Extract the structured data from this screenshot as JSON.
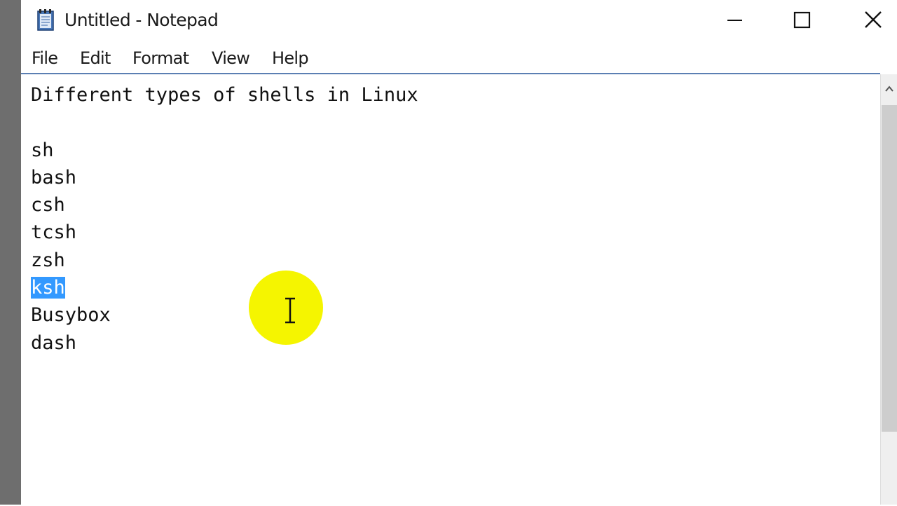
{
  "window": {
    "title": "Untitled - Notepad",
    "app_icon": "notepad-icon",
    "controls": [
      "minimize-icon",
      "maximize-icon",
      "close-icon"
    ]
  },
  "menubar": {
    "file": "File",
    "edit": "Edit",
    "format": "Format",
    "view": "View",
    "help": "Help"
  },
  "editor": {
    "lines": [
      "Different types of shells in Linux",
      "",
      "sh",
      "bash",
      "csh",
      "tcsh",
      "zsh",
      "ksh",
      "Busybox",
      "dash"
    ],
    "selected_line_index": 7,
    "selected_text": "ksh"
  },
  "colors": {
    "selection": "#3399ff",
    "cursor_highlight": "#f5f500",
    "menubar_border": "#5b7fb3"
  }
}
